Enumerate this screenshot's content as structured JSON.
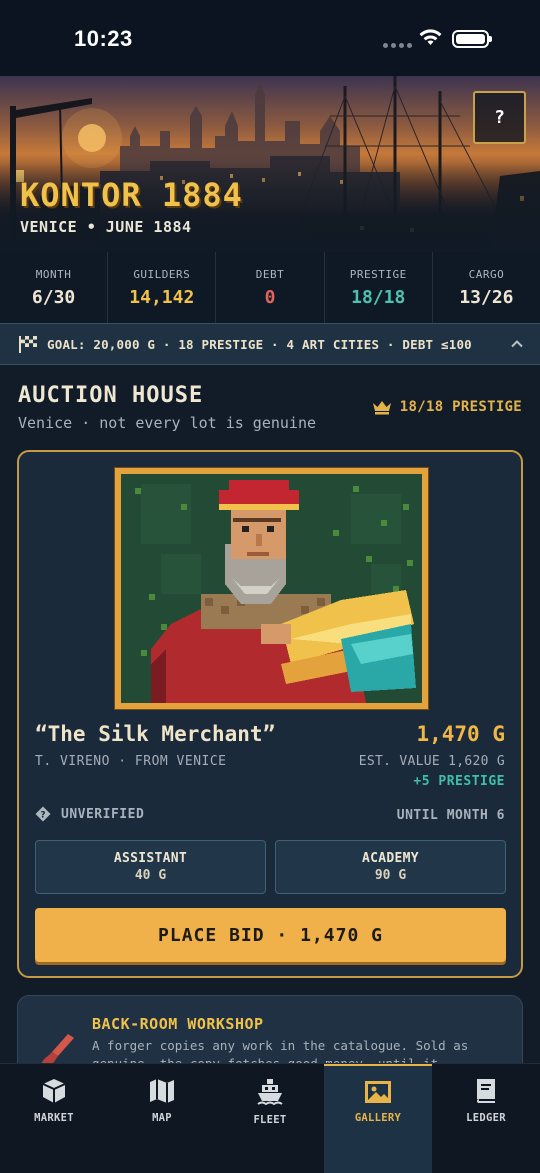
{
  "status_bar": {
    "time": "10:23"
  },
  "header": {
    "title": "KONTOR 1884",
    "subtitle": "VENICE • JUNE 1884",
    "help_label": "?"
  },
  "stats": [
    {
      "label": "MONTH",
      "value": "6/30",
      "color": "#eee6d2"
    },
    {
      "label": "GUILDERS",
      "value": "14,142",
      "color": "#f0c24c"
    },
    {
      "label": "DEBT",
      "value": "0",
      "color": "#e0645a"
    },
    {
      "label": "PRESTIGE",
      "value": "18/18",
      "color": "#4cc3ae"
    },
    {
      "label": "CARGO",
      "value": "13/26",
      "color": "#eee6d2"
    }
  ],
  "goal": {
    "text": "GOAL: 20,000 G · 18 PRESTIGE · 4 ART CITIES · DEBT ≤100"
  },
  "auction": {
    "title": "AUCTION HOUSE",
    "subtitle": "Venice · not every lot is genuine",
    "prestige": "18/18 PRESTIGE"
  },
  "lot": {
    "title": "“The Silk Merchant”",
    "price": "1,470 G",
    "artist": "T. VIRENO · FROM VENICE",
    "estimate": "EST. VALUE 1,620 G",
    "bonus": "+5 PRESTIGE",
    "status": "UNVERIFIED",
    "until": "UNTIL MONTH 6",
    "options": [
      {
        "label": "ASSISTANT",
        "cost": "40 G"
      },
      {
        "label": "ACADEMY",
        "cost": "90 G"
      }
    ],
    "bid_label": "PLACE BID · 1,470 G"
  },
  "workshop": {
    "title": "BACK-ROOM WORKSHOP",
    "description": "A forger copies any work in the catalogue. Sold as genuine, the copy fetches good money, until it"
  },
  "tabs": [
    {
      "label": "MARKET",
      "icon": "crate-icon"
    },
    {
      "label": "MAP",
      "icon": "map-icon"
    },
    {
      "label": "FLEET",
      "icon": "ship-icon"
    },
    {
      "label": "GALLERY",
      "icon": "picture-icon",
      "active": true
    },
    {
      "label": "LEDGER",
      "icon": "book-icon"
    }
  ],
  "colors": {
    "accent": "#f0b04a",
    "gold": "#f0c24c",
    "teal": "#4cc3ae",
    "red": "#e0645a",
    "background": "#121c29"
  }
}
